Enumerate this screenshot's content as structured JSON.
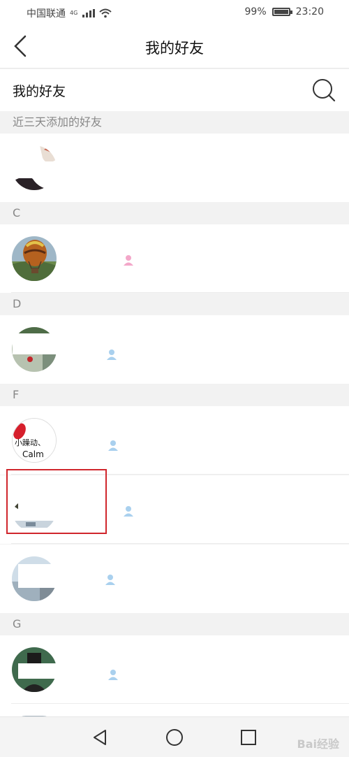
{
  "status_bar": {
    "carrier": "中国联通",
    "network": "4G",
    "battery": "99%",
    "time": "23:20"
  },
  "header": {
    "title": "我的好友",
    "back_icon": "chevron-left-icon"
  },
  "search": {
    "label": "我的好友",
    "icon": "search-icon"
  },
  "sections": [
    {
      "header": "近三天添加的好友"
    },
    {
      "header": "C"
    },
    {
      "header": "D"
    },
    {
      "header": "F"
    },
    {
      "header": "G"
    }
  ],
  "friends": [
    {
      "section": "近三天添加的好友",
      "avatar": "avatar-dark-portrait"
    },
    {
      "section": "C",
      "avatar": "hot-air-balloon",
      "gender_color": "#f3a7c9"
    },
    {
      "section": "D",
      "avatar": "green-landscape",
      "gender_color": "#a9d0ee"
    },
    {
      "section": "F",
      "avatar": "calm-text-avatar",
      "avatar_text": "小躁动、Calm",
      "gender_color": "#a9d0ee"
    },
    {
      "section": "F",
      "avatar": "dim-scene",
      "gender_color": "#a9d0ee"
    },
    {
      "section": "F",
      "avatar": "sky-scene",
      "gender_color": "#a9d0ee"
    },
    {
      "section": "G",
      "avatar": "figure-hat",
      "gender_color": "#a9d0ee"
    }
  ],
  "nav": {
    "back": "back-triangle-icon",
    "home": "home-circle-icon",
    "recents": "recents-square-icon"
  },
  "watermark": "Bai经验"
}
